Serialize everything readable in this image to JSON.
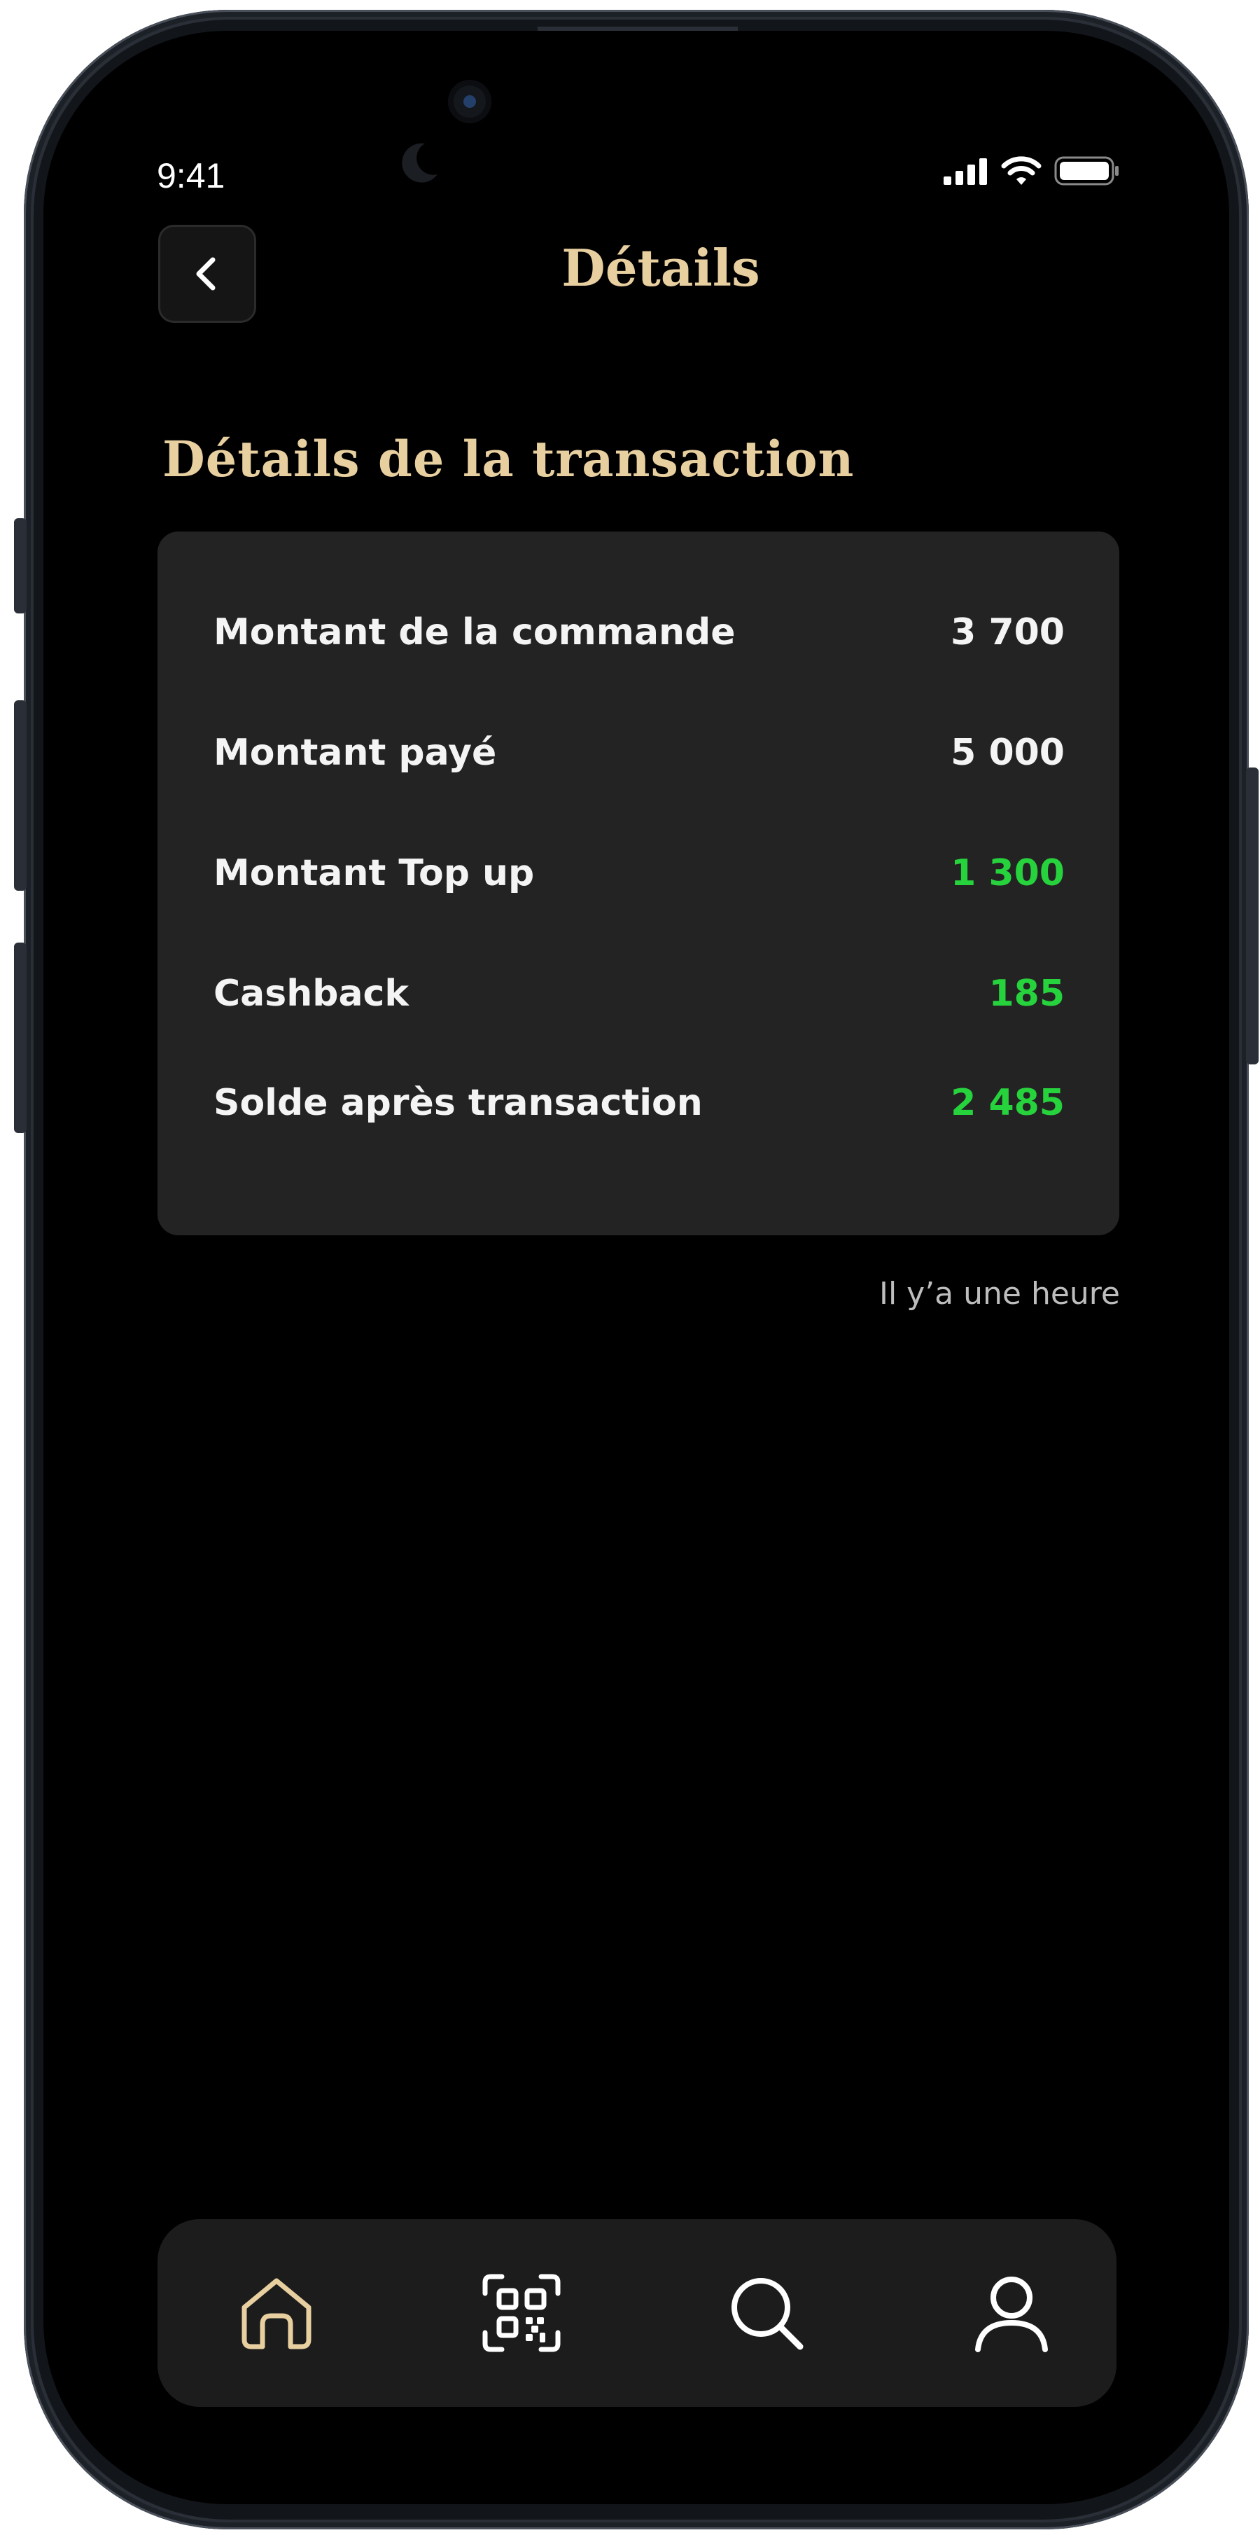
{
  "status_bar": {
    "time": "9:41"
  },
  "header": {
    "title": "Détails",
    "back_icon": "chevron-left-icon"
  },
  "section": {
    "title": "Détails de la transaction"
  },
  "details": {
    "rows": [
      {
        "label": "Montant de la commande",
        "value": "3 700",
        "highlight": false
      },
      {
        "label": "Montant payé",
        "value": "5 000",
        "highlight": false
      },
      {
        "label": "Montant Top up",
        "value": "1 300",
        "highlight": true
      },
      {
        "label": "Cashback",
        "value": "185",
        "highlight": true
      },
      {
        "label": "Solde après transaction",
        "value": "2 485",
        "highlight": true
      }
    ]
  },
  "timestamp": "Il y’a une heure",
  "bottom_nav": {
    "items": [
      {
        "icon": "home-icon",
        "active": true
      },
      {
        "icon": "qr-code-icon",
        "active": false
      },
      {
        "icon": "search-icon",
        "active": false
      },
      {
        "icon": "profile-icon",
        "active": false
      }
    ]
  },
  "colors": {
    "accent_gold": "#e8cfa0",
    "positive_green": "#27d33d",
    "background": "#000000",
    "card": "#232323"
  }
}
